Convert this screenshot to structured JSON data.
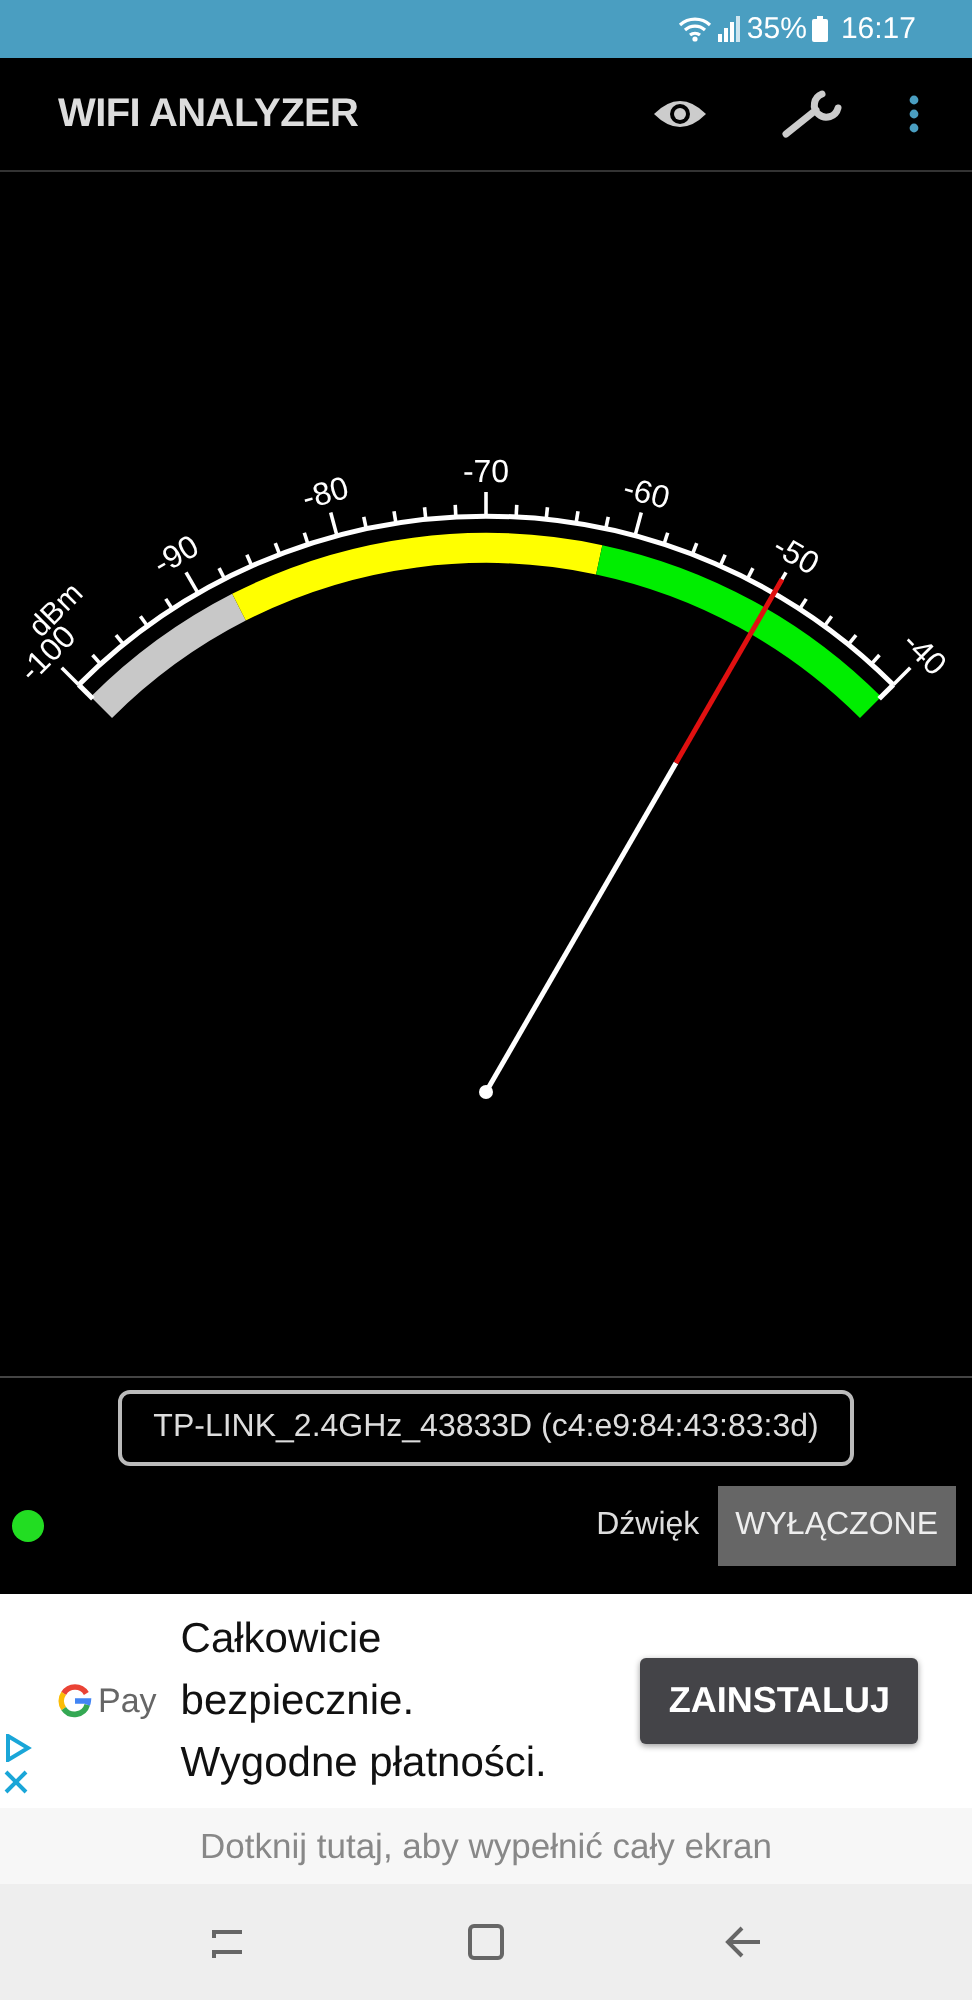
{
  "status_bar": {
    "battery": "35%",
    "time": "16:17"
  },
  "toolbar": {
    "title": "WIFI ANALYZER"
  },
  "gauge": {
    "unit": "dBm",
    "scale_labels": [
      "-100",
      "-90",
      "-80",
      "-70",
      "-60",
      "-50",
      "-40"
    ]
  },
  "network": {
    "name": "TP-LINK_2.4GHz_43833D (c4:e9:84:43:83:3d)",
    "connected": true,
    "sound_label": "Dźwięk",
    "sound_button": "WYŁĄCZONE"
  },
  "ad": {
    "brand": "Pay",
    "headline": "Całkowicie bezpiecznie. Wygodne płatności.",
    "button": "ZAINSTALUJ",
    "fullscreen_hint": "Dotknij tutaj, aby wypełnić cały ekran"
  }
}
